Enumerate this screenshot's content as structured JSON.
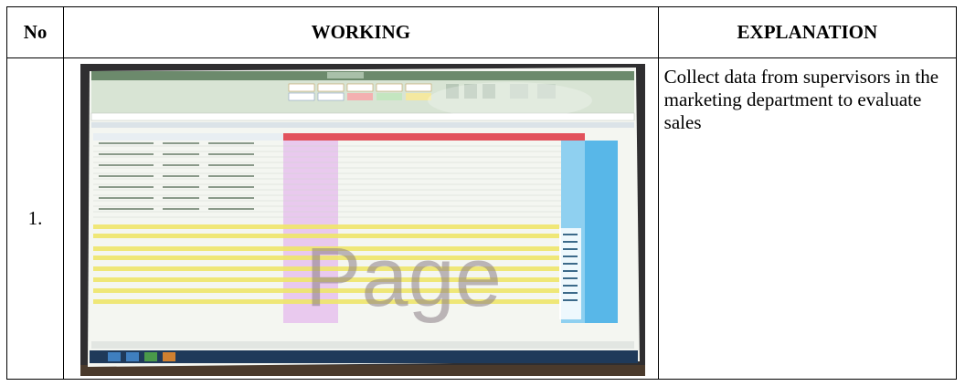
{
  "table": {
    "headers": {
      "no": "No",
      "working": "WORKING",
      "explanation": "EXPLANATION"
    },
    "rows": [
      {
        "no": "1.",
        "explanation": "Collect data from supervisors in the marketing department to evaluate sales",
        "photo": {
          "description_overlay_text": "Page",
          "colors": {
            "ribbon": "#d8e4d4",
            "sheet": "#f4f6f1",
            "highlight_yellow": "#efe66a",
            "pink_band": "#e9c9ee",
            "blue_column": "#58b7e8",
            "red_header": "#e2525c",
            "bezel": "#2f2e30"
          }
        }
      }
    ]
  }
}
